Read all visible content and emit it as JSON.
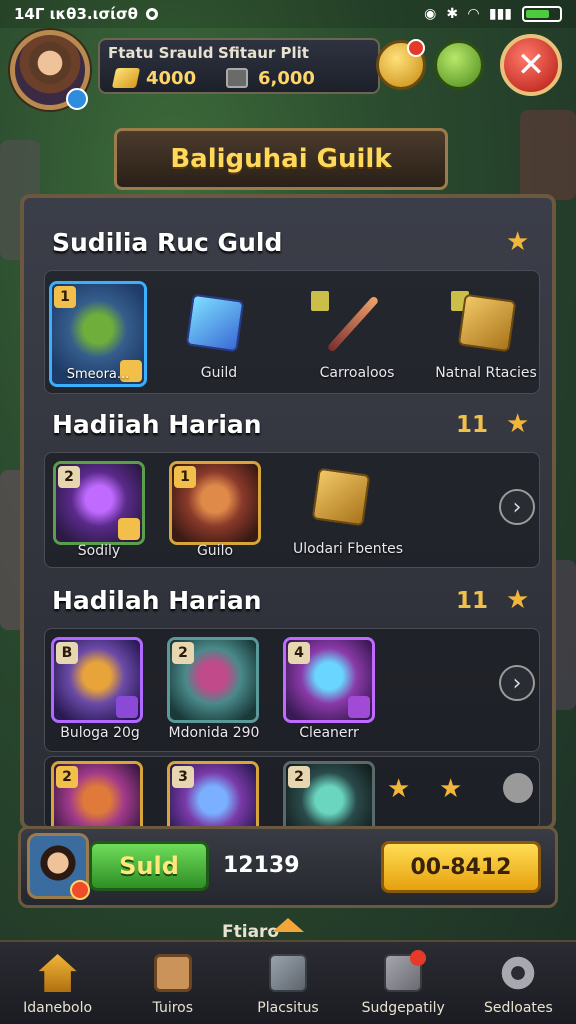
{
  "status_bar": {
    "time": "14Γ ικθ3.ισίσθ"
  },
  "hud": {
    "resource1_label": "Ftatu Srauld",
    "resource1_value": "4000",
    "resource2_label": "Sfitaur Plit",
    "resource2_value": "6,000"
  },
  "title": "Baliguhai Guilk",
  "sections": [
    {
      "title": "Sudilia Ruc Guld",
      "items": [
        {
          "caption": "Smeora...",
          "number": "1"
        },
        {
          "caption": "Guild"
        },
        {
          "caption": "Carroaloos"
        },
        {
          "caption": "Natnal Rtacies"
        }
      ]
    },
    {
      "title": "Hadiiah Harian",
      "count": "11",
      "items": [
        {
          "caption": "Sodily",
          "number": "2"
        },
        {
          "caption": "Guilo",
          "number": "1"
        },
        {
          "caption": "Ulodari Fbentes"
        }
      ]
    },
    {
      "title": "Hadilah Harian",
      "count": "11",
      "items": [
        {
          "caption": "Buloga 20g",
          "number": "B"
        },
        {
          "caption": "Mdonida 290",
          "number": "2"
        },
        {
          "caption": "Cleanerr",
          "number": "4"
        }
      ],
      "extra_row": [
        {
          "number": "2"
        },
        {
          "number": "3"
        },
        {
          "number": "2"
        }
      ]
    }
  ],
  "action_bar": {
    "sold_label": "Suld",
    "price": "12139",
    "gold_button_label": "00-8412"
  },
  "more_label": "Ftiaro",
  "nav": [
    {
      "label": "Idanebolo"
    },
    {
      "label": "Tuiros"
    },
    {
      "label": "Placsitus"
    },
    {
      "label": "Sudgepatily"
    },
    {
      "label": "Sedloates"
    }
  ],
  "colors": {
    "accent_gold": "#f2c04a",
    "close_red": "#b3170f",
    "sold_green": "#2e8f25"
  }
}
